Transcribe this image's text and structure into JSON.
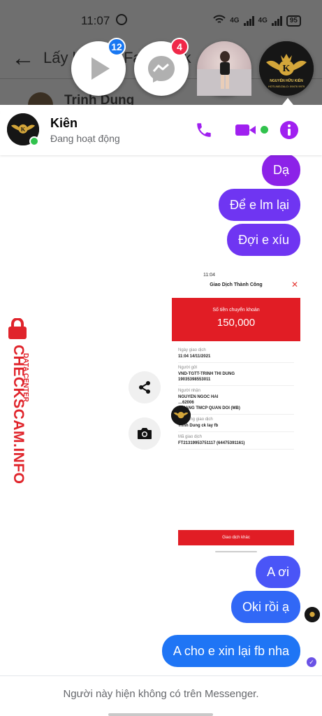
{
  "status_bar": {
    "time": "11:07",
    "network_label": "4G",
    "battery": "95"
  },
  "background": {
    "title": "Lấy lại nick Facebook",
    "contact_name": "Trinh Dung"
  },
  "chat_heads": [
    {
      "name": "play-video-head",
      "badge": "12",
      "badge_color": "#1877f2"
    },
    {
      "name": "messenger-head",
      "badge": "4",
      "badge_color": "#f02849"
    },
    {
      "name": "photo-contact-head"
    },
    {
      "name": "kien-logo-head"
    }
  ],
  "logo_text": {
    "line1": "NGUYỄN HỮU KIÊN",
    "line2": "HOTLINE/ZALO: 09476 9979"
  },
  "chat": {
    "contact_name": "Kiên",
    "contact_status": "Đang hoạt động",
    "messages": [
      {
        "text": "Dạ"
      },
      {
        "text": "Để e lm lại"
      },
      {
        "text": "Đợi e xíu"
      },
      {
        "text": "A ơi"
      },
      {
        "text": "Oki rồi ạ"
      },
      {
        "text": "A cho e xin lại fb nha"
      }
    ],
    "footer_text": "Người này hiện không có trên Messenger."
  },
  "receipt": {
    "time": "11:04",
    "title": "Giao Dịch Thành Công",
    "amount_label": "Số tiền chuyển khoản",
    "amount": "150,000",
    "fields": [
      {
        "key": "Ngày giao dịch",
        "value": "11:04 14/11/2021"
      },
      {
        "key": "Người gửi",
        "value": "VND-TGTT-TRINH THI DUNG\n19035398553011"
      },
      {
        "key": "Người nhận",
        "value": "NGUYEN NGOC HAI\n…62006\n…HANG TMCP QUAN DOI (MB)"
      },
      {
        "key": "Nội dung giao dịch",
        "value": "Trinh Dung ck lay fb"
      },
      {
        "key": "Mã giao dịch",
        "value": "FT21319953751117 (64475391161)"
      }
    ],
    "button": "Giao dịch khác"
  },
  "watermark": {
    "main": "CHECKSCAM.INFO",
    "sub": "DATA CENTER"
  },
  "colors": {
    "accent": "#a020f0",
    "online": "#31c24d",
    "brand_red": "#e0242b"
  }
}
